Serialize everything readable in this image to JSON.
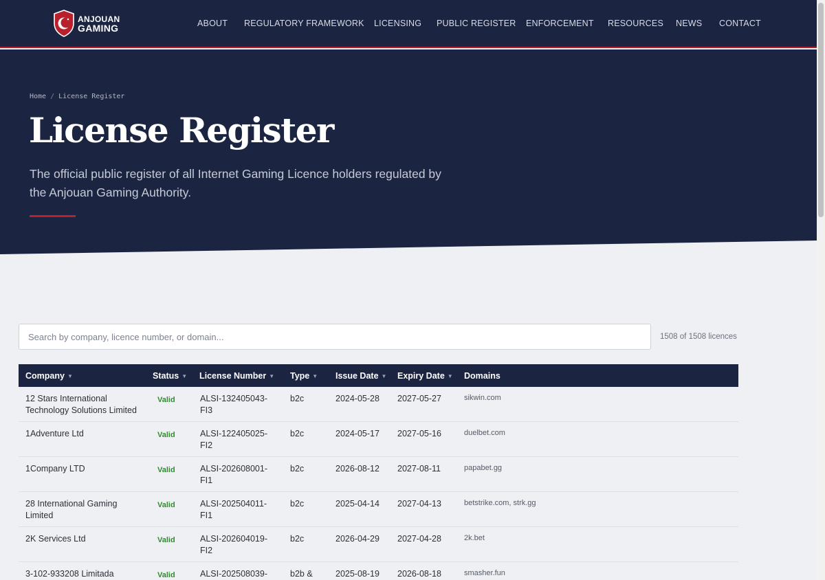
{
  "brand": {
    "line1": "ANJOUAN",
    "line2": "GAMING",
    "accent_color": "#b8202c",
    "navy_color": "#1b2440"
  },
  "nav": [
    "ABOUT",
    "REGULATORY FRAMEWORK",
    "LICENSING",
    "PUBLIC REGISTER",
    "ENFORCEMENT",
    "RESOURCES",
    "NEWS",
    "CONTACT"
  ],
  "breadcrumb": {
    "home": "Home",
    "separator": "/",
    "current": "License Register"
  },
  "hero": {
    "title": "License Register",
    "subtitle": "The official public register of all Internet Gaming Licence holders regulated by the Anjouan Gaming Authority."
  },
  "search": {
    "placeholder": "Search by company, licence number, or domain...",
    "value": ""
  },
  "count": "1508 of 1508 licences",
  "table": {
    "columns": [
      "Company",
      "Status",
      "License Number",
      "Type",
      "Issue Date",
      "Expiry Date",
      "Domains"
    ],
    "rows": [
      {
        "company": "12 Stars International Technology Solutions Limited",
        "status": "Valid",
        "license": "ALSI-132405043-FI3",
        "type": "b2c",
        "issue": "2024-05-28",
        "expiry": "2027-05-27",
        "domains": "sikwin.com"
      },
      {
        "company": "1Adventure Ltd",
        "status": "Valid",
        "license": "ALSI-122405025-FI2",
        "type": "b2c",
        "issue": "2024-05-17",
        "expiry": "2027-05-16",
        "domains": "duelbet.com"
      },
      {
        "company": "1Company LTD",
        "status": "Valid",
        "license": "ALSI-202608001-FI1",
        "type": "b2c",
        "issue": "2026-08-12",
        "expiry": "2027-08-11",
        "domains": "papabet.gg"
      },
      {
        "company": "28 International Gaming Limited",
        "status": "Valid",
        "license": "ALSI-202504011-FI1",
        "type": "b2c",
        "issue": "2025-04-14",
        "expiry": "2027-04-13",
        "domains": "betstrike.com, strk.gg"
      },
      {
        "company": "2K Services Ltd",
        "status": "Valid",
        "license": "ALSI-202604019-FI2",
        "type": "b2c",
        "issue": "2026-04-29",
        "expiry": "2027-04-28",
        "domains": "2k.bet"
      },
      {
        "company": "3-102-933208 Limitada",
        "status": "Valid",
        "license": "ALSI-202508039-",
        "type": "b2b &",
        "issue": "2025-08-19",
        "expiry": "2026-08-18",
        "domains": "smasher.fun"
      }
    ]
  }
}
